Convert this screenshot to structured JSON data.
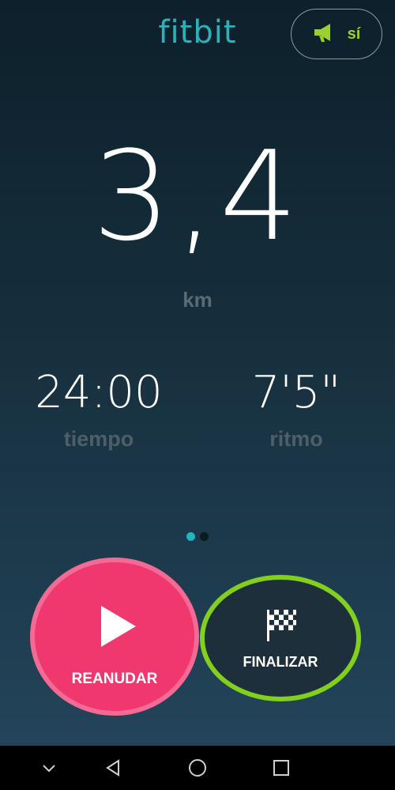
{
  "header": {
    "logo_text": "fitbit",
    "cue_toggle": {
      "label": "sí",
      "icon": "megaphone-icon"
    }
  },
  "main": {
    "distance_value": "3,4",
    "distance_unit": "km",
    "stats": [
      {
        "value": "24:00",
        "label": "tiempo"
      },
      {
        "value": "7'5\"",
        "label": "ritmo"
      }
    ],
    "pager": {
      "pages": 2,
      "active": 1
    }
  },
  "actions": {
    "resume": {
      "label": "REANUDAR",
      "icon": "play-icon"
    },
    "finish": {
      "label": "FINALIZAR",
      "icon": "checkered-flag-icon"
    }
  },
  "navbar": {
    "icons": [
      "chevron-down-icon",
      "back-triangle-icon",
      "home-circle-icon",
      "recents-square-icon"
    ]
  },
  "colors": {
    "brand": "#2ab1ba",
    "cue_accent": "#9ad12f",
    "resume": "#f0386f",
    "finish_ring": "#83cf1e"
  }
}
